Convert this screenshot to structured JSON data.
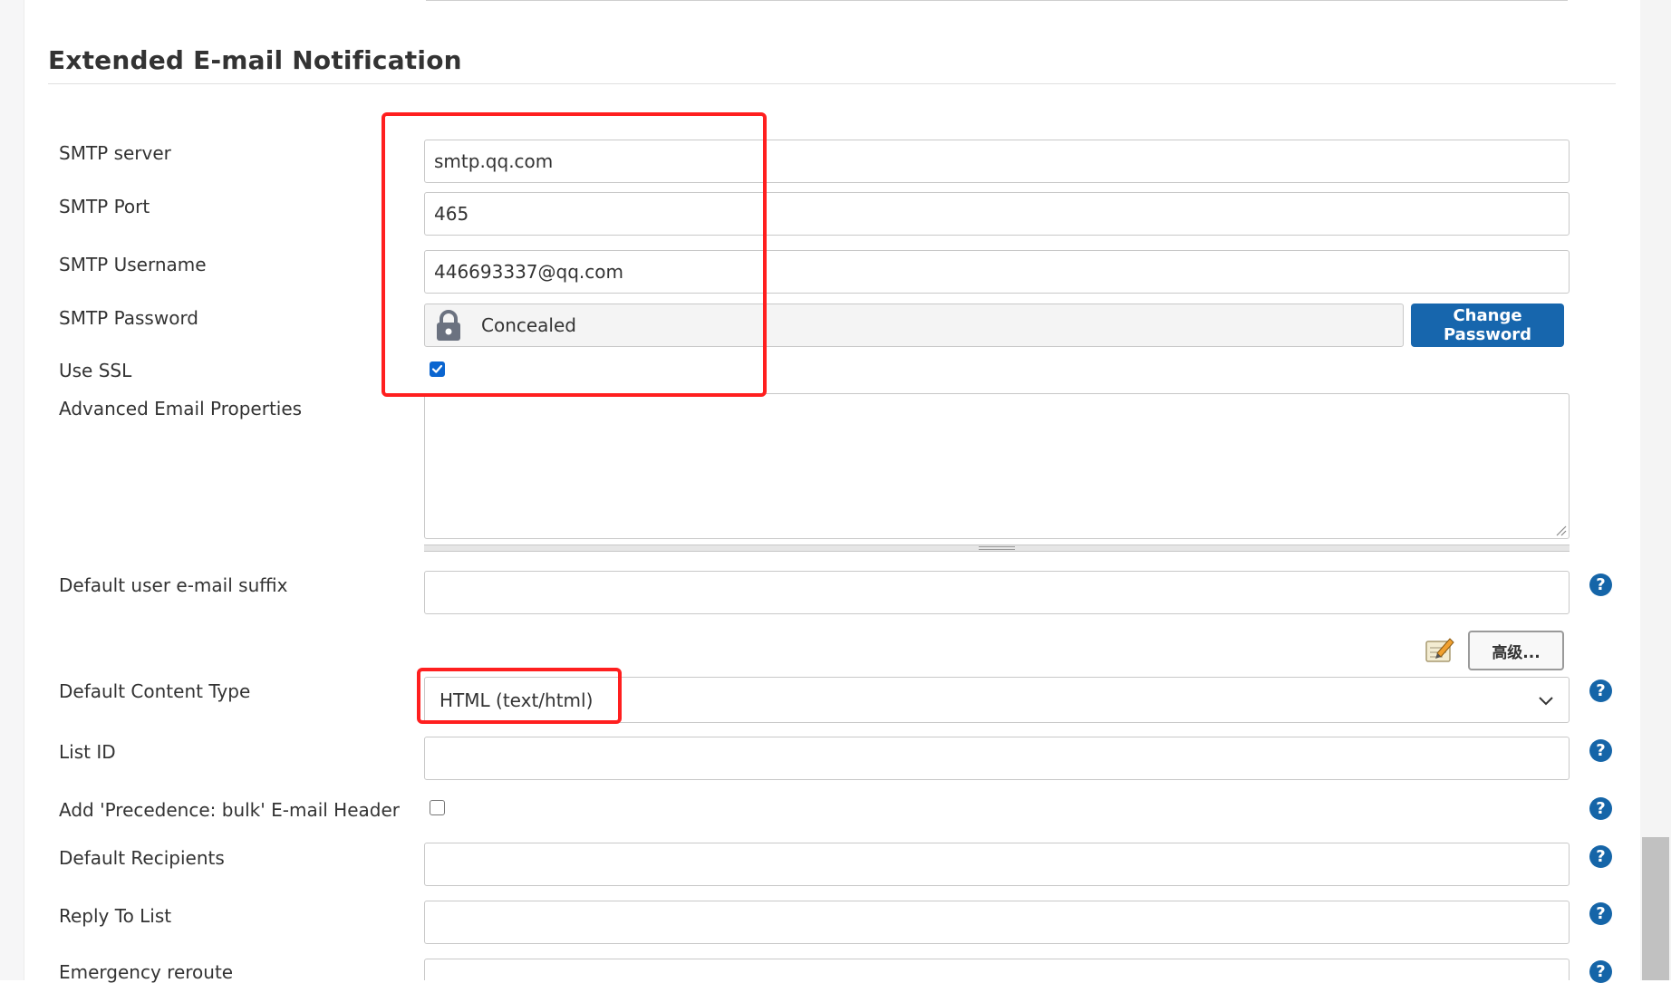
{
  "section": {
    "title": "Extended E-mail Notification"
  },
  "fields": {
    "smtp_server": {
      "label": "SMTP server",
      "value": "smtp.qq.com"
    },
    "smtp_port": {
      "label": "SMTP Port",
      "value": "465"
    },
    "smtp_username": {
      "label": "SMTP Username",
      "value": "446693337@qq.com"
    },
    "smtp_password": {
      "label": "SMTP Password",
      "value": "Concealed",
      "button": "Change Password"
    },
    "use_ssl": {
      "label": "Use SSL",
      "checked": true
    },
    "advanced_props": {
      "label": "Advanced Email Properties",
      "value": ""
    },
    "default_suffix": {
      "label": "Default user e-mail suffix",
      "value": ""
    },
    "advanced_button": "高级...",
    "content_type": {
      "label": "Default Content Type",
      "selected": "HTML (text/html)"
    },
    "list_id": {
      "label": "List ID",
      "value": ""
    },
    "precedence": {
      "label": "Add 'Precedence: bulk' E-mail Header",
      "checked": false
    },
    "default_recipients": {
      "label": "Default Recipients",
      "value": ""
    },
    "reply_to": {
      "label": "Reply To List",
      "value": ""
    },
    "emergency": {
      "label": "Emergency reroute",
      "value": ""
    }
  },
  "help_symbol": "?",
  "colors": {
    "primary": "#1766ad",
    "highlight": "#ff1f1f",
    "checkbox": "#0a65d0"
  }
}
